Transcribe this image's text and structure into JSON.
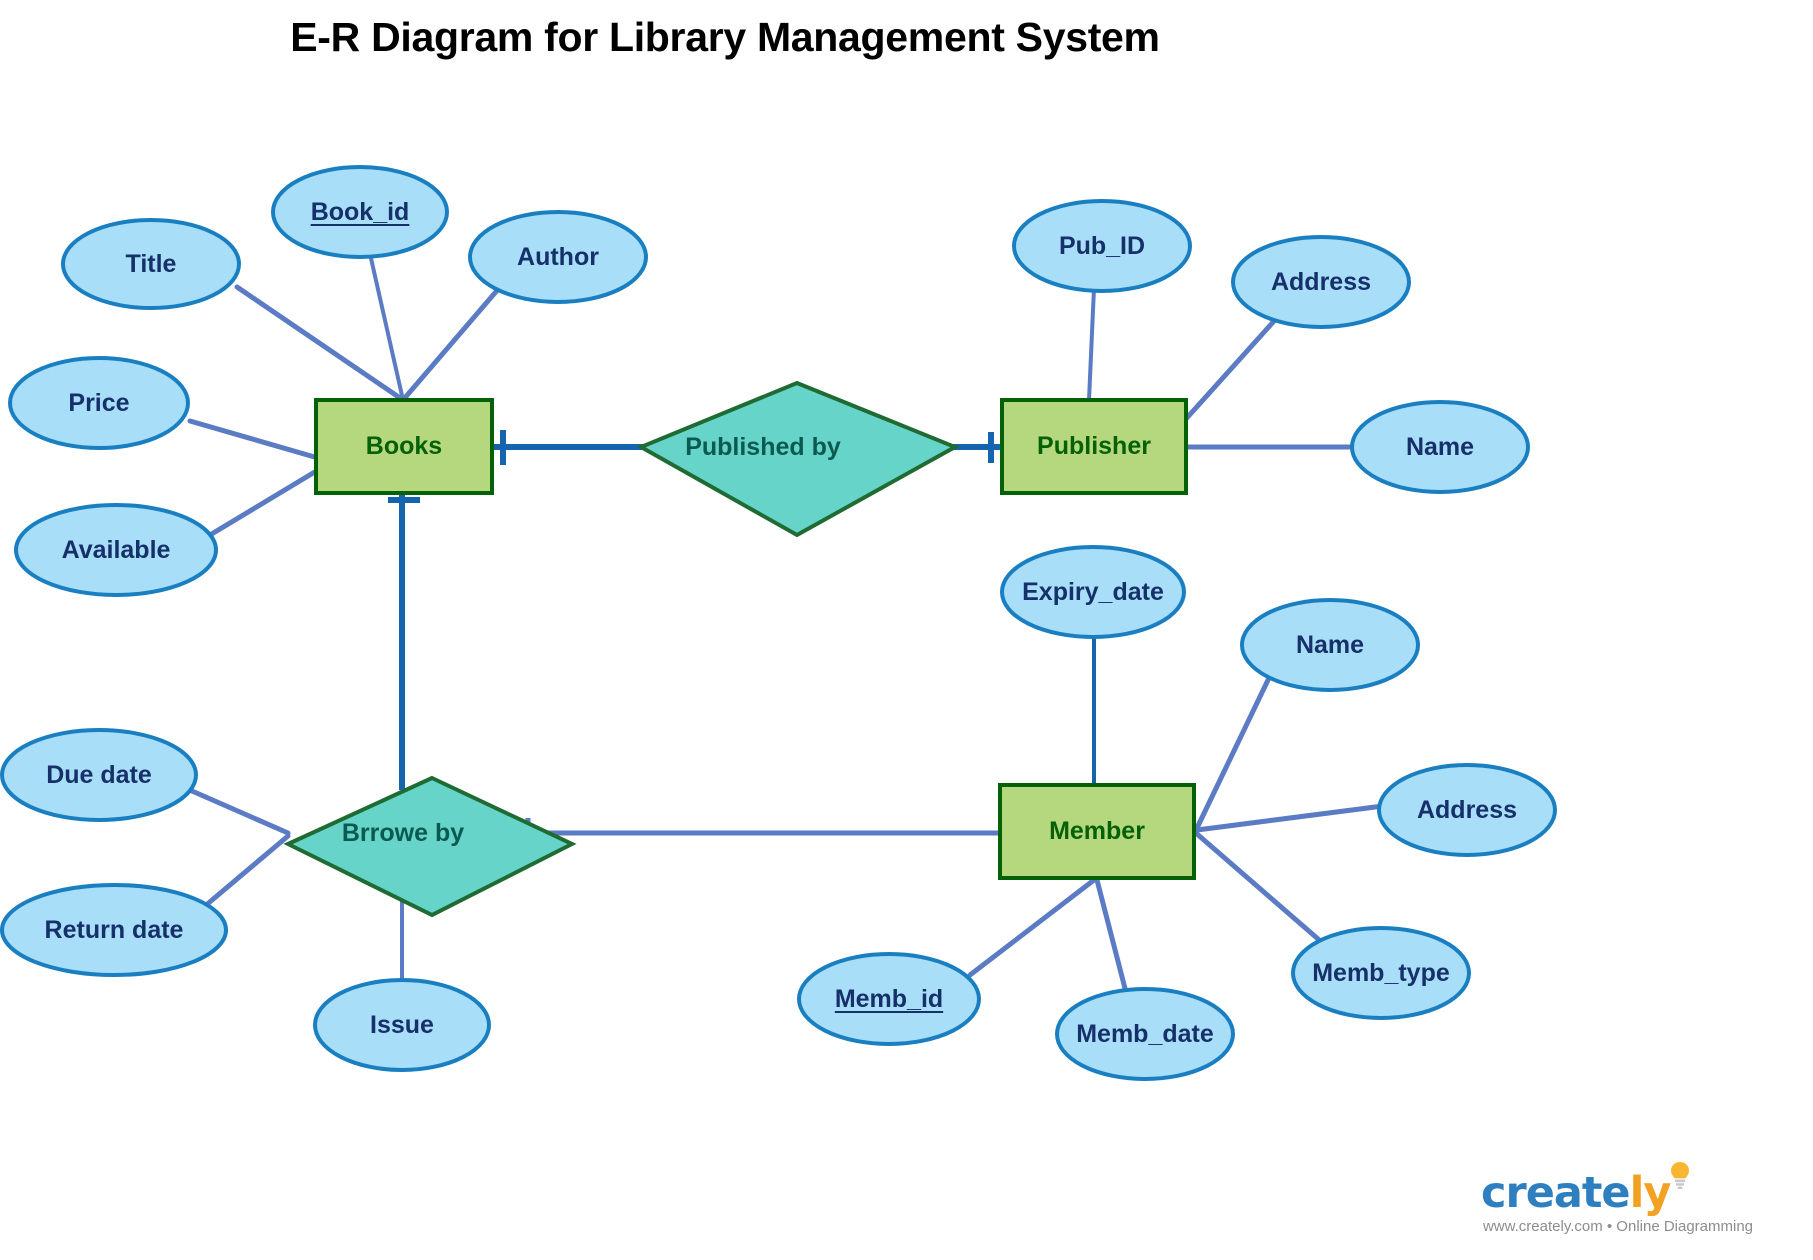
{
  "page": {
    "title": "E-R Diagram for Library Management System",
    "background": "#ffffff"
  },
  "palette": {
    "attribute_fill": "#A9DEF9",
    "attribute_stroke": "#1A7FC1",
    "attribute_text": "#16306a",
    "entity_fill": "#B5D87E",
    "entity_stroke": "#056105",
    "entity_text": "#056105",
    "relationship_fill": "#66D4C8",
    "relationship_stroke": "#1f6b33",
    "relationship_text": "#0b5a52",
    "attribute_link": "#5B7BC4",
    "relationship_link": "#1565AE"
  },
  "entities": [
    {
      "id": "books",
      "label": "Books"
    },
    {
      "id": "publisher",
      "label": "Publisher"
    },
    {
      "id": "member",
      "label": "Member"
    }
  ],
  "relationships": [
    {
      "id": "published_by",
      "label": "Published by"
    },
    {
      "id": "brrowe_by",
      "label": "Brrowe by"
    }
  ],
  "attributes": [
    {
      "id": "book_id",
      "label": "Book_id",
      "owner": "books",
      "primary_key": true
    },
    {
      "id": "title",
      "label": "Title",
      "owner": "books",
      "primary_key": false
    },
    {
      "id": "author",
      "label": "Author",
      "owner": "books",
      "primary_key": false
    },
    {
      "id": "price",
      "label": "Price",
      "owner": "books",
      "primary_key": false
    },
    {
      "id": "available",
      "label": "Available",
      "owner": "books",
      "primary_key": false
    },
    {
      "id": "pub_id",
      "label": "Pub_ID",
      "owner": "publisher",
      "primary_key": false
    },
    {
      "id": "pub_address",
      "label": "Address",
      "owner": "publisher",
      "primary_key": false
    },
    {
      "id": "pub_name",
      "label": "Name",
      "owner": "publisher",
      "primary_key": false
    },
    {
      "id": "expiry_date",
      "label": "Expiry_date",
      "owner": "member",
      "primary_key": false
    },
    {
      "id": "mem_name",
      "label": "Name",
      "owner": "member",
      "primary_key": false
    },
    {
      "id": "mem_address",
      "label": "Address",
      "owner": "member",
      "primary_key": false
    },
    {
      "id": "memb_type",
      "label": "Memb_type",
      "owner": "member",
      "primary_key": false
    },
    {
      "id": "memb_id",
      "label": "Memb_id",
      "owner": "member",
      "primary_key": true
    },
    {
      "id": "memb_date",
      "label": "Memb_date",
      "owner": "member",
      "primary_key": false
    },
    {
      "id": "due_date",
      "label": "Due date",
      "owner": "brrowe_by",
      "primary_key": false
    },
    {
      "id": "return_date",
      "label": "Return date",
      "owner": "brrowe_by",
      "primary_key": false
    },
    {
      "id": "issue",
      "label": "Issue",
      "owner": "brrowe_by",
      "primary_key": false
    }
  ],
  "connections": [
    {
      "from": "title",
      "to": "books"
    },
    {
      "from": "book_id",
      "to": "books"
    },
    {
      "from": "author",
      "to": "books"
    },
    {
      "from": "price",
      "to": "books"
    },
    {
      "from": "available",
      "to": "books"
    },
    {
      "from": "books",
      "to": "published_by",
      "cardinality": "one"
    },
    {
      "from": "published_by",
      "to": "publisher",
      "cardinality": "one"
    },
    {
      "from": "pub_id",
      "to": "publisher"
    },
    {
      "from": "pub_address",
      "to": "publisher"
    },
    {
      "from": "pub_name",
      "to": "publisher"
    },
    {
      "from": "books",
      "to": "brrowe_by",
      "cardinality": "one"
    },
    {
      "from": "brrowe_by",
      "to": "member",
      "cardinality": "one"
    },
    {
      "from": "due_date",
      "to": "brrowe_by"
    },
    {
      "from": "return_date",
      "to": "brrowe_by"
    },
    {
      "from": "issue",
      "to": "brrowe_by"
    },
    {
      "from": "expiry_date",
      "to": "member"
    },
    {
      "from": "mem_name",
      "to": "member"
    },
    {
      "from": "mem_address",
      "to": "member"
    },
    {
      "from": "memb_type",
      "to": "member"
    },
    {
      "from": "memb_id",
      "to": "member"
    },
    {
      "from": "memb_date",
      "to": "member"
    }
  ],
  "watermark": {
    "brand_primary": "create",
    "brand_accent": "ly",
    "tagline": "www.creately.com • Online Diagramming"
  }
}
